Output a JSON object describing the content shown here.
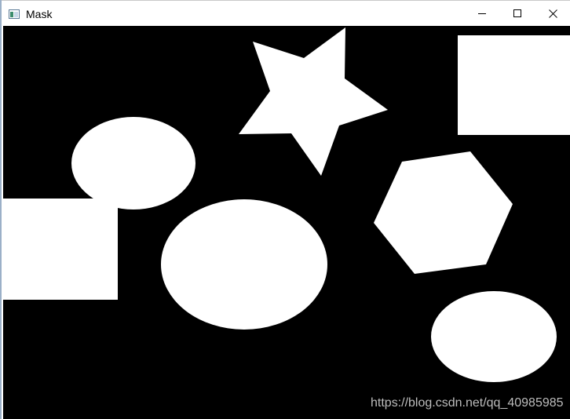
{
  "window": {
    "title": "Mask",
    "icon": "app-window-icon",
    "controls": {
      "minimize_icon": "minimize-icon",
      "maximize_icon": "maximize-icon",
      "close_icon": "close-icon"
    }
  },
  "canvas": {
    "background_color": "#000000",
    "shape_color": "#ffffff",
    "shapes": [
      "ellipse",
      "ellipse",
      "ellipse",
      "star",
      "square",
      "rectangle",
      "hexagon"
    ]
  },
  "watermark": {
    "text": "https://blog.csdn.net/qq_40985985"
  }
}
